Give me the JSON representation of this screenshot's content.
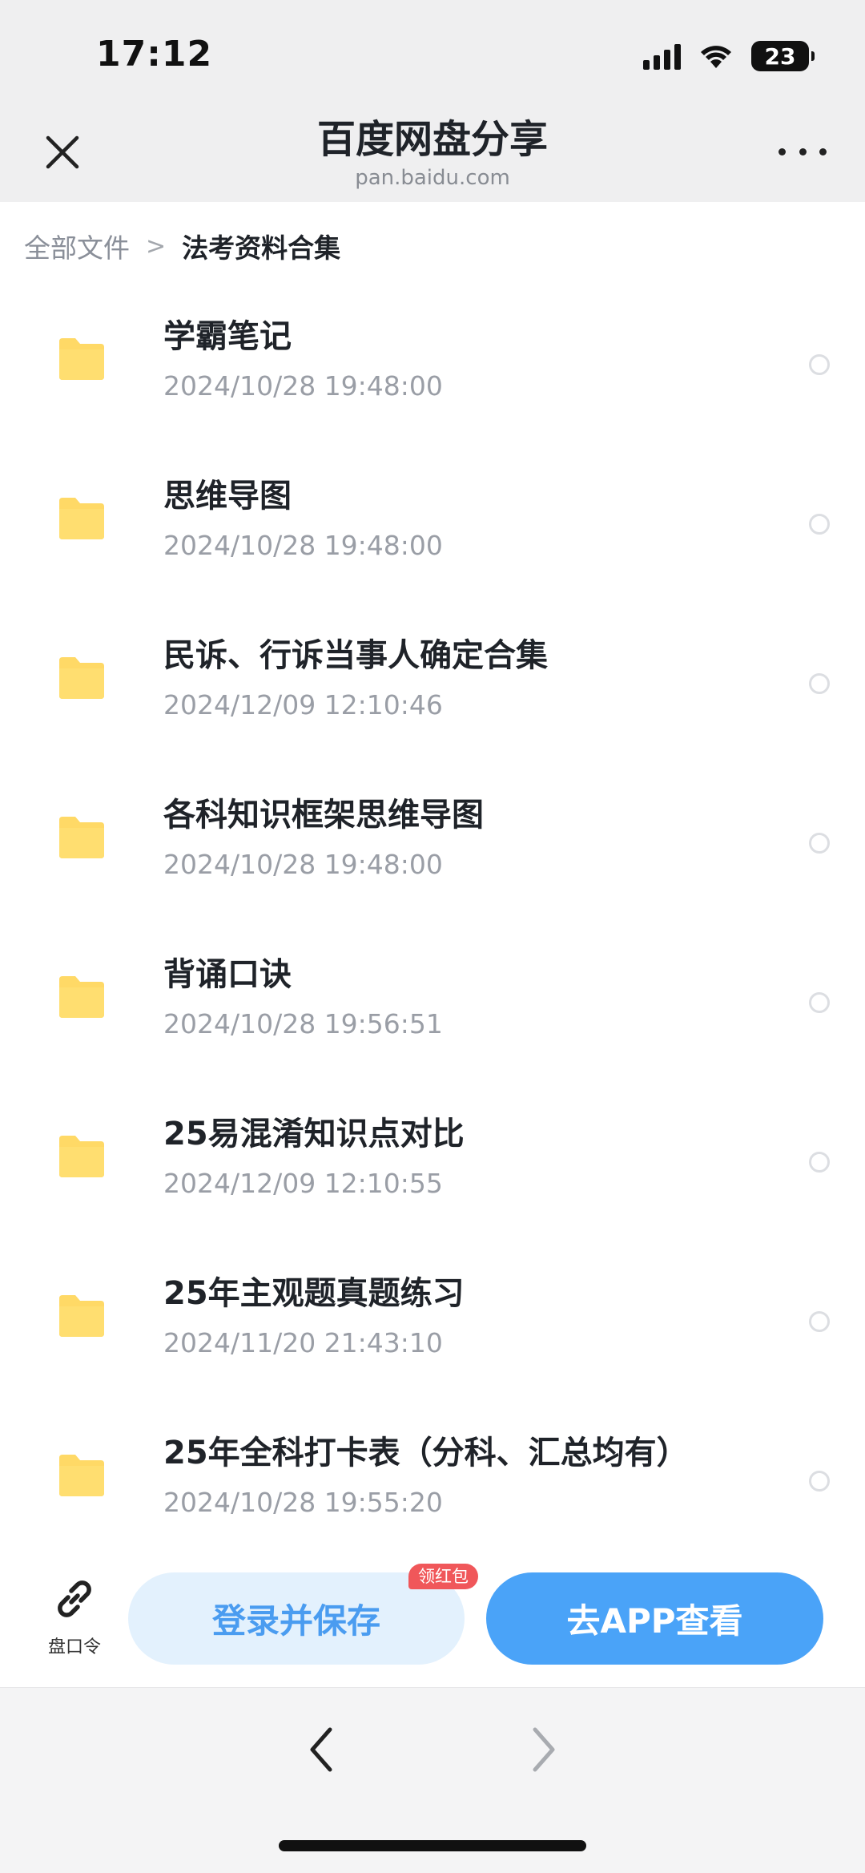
{
  "status_bar": {
    "time": "17:12",
    "battery": "23"
  },
  "nav": {
    "title": "百度网盘分享",
    "subtitle": "pan.baidu.com"
  },
  "breadcrumb": {
    "root": "全部文件",
    "separator": ">",
    "current": "法考资料合集"
  },
  "files": [
    {
      "name": "学霸笔记",
      "date": "2024/10/28 19:48:00"
    },
    {
      "name": "思维导图",
      "date": "2024/10/28 19:48:00"
    },
    {
      "name": "民诉、行诉当事人确定合集",
      "date": "2024/12/09 12:10:46"
    },
    {
      "name": "各科知识框架思维导图",
      "date": "2024/10/28 19:48:00"
    },
    {
      "name": "背诵口诀",
      "date": "2024/10/28 19:56:51"
    },
    {
      "name": "25易混淆知识点对比",
      "date": "2024/12/09 12:10:55"
    },
    {
      "name": "25年主观题真题练习",
      "date": "2024/11/20 21:43:10"
    },
    {
      "name": "25年全科打卡表（分科、汇总均有）",
      "date": "2024/10/28 19:55:20"
    }
  ],
  "actions": {
    "share_code_label": "盘口令",
    "login_save": "登录并保存",
    "badge": "领红包",
    "open_app": "去APP查看"
  },
  "colors": {
    "folder": "#ffd966",
    "primary": "#4aa3f8",
    "primary_light": "#e3f1fd",
    "badge": "#f0575a"
  },
  "icons": [
    "close-icon",
    "more-icon",
    "folder-icon",
    "link-icon",
    "back-arrow-icon",
    "forward-arrow-icon"
  ]
}
